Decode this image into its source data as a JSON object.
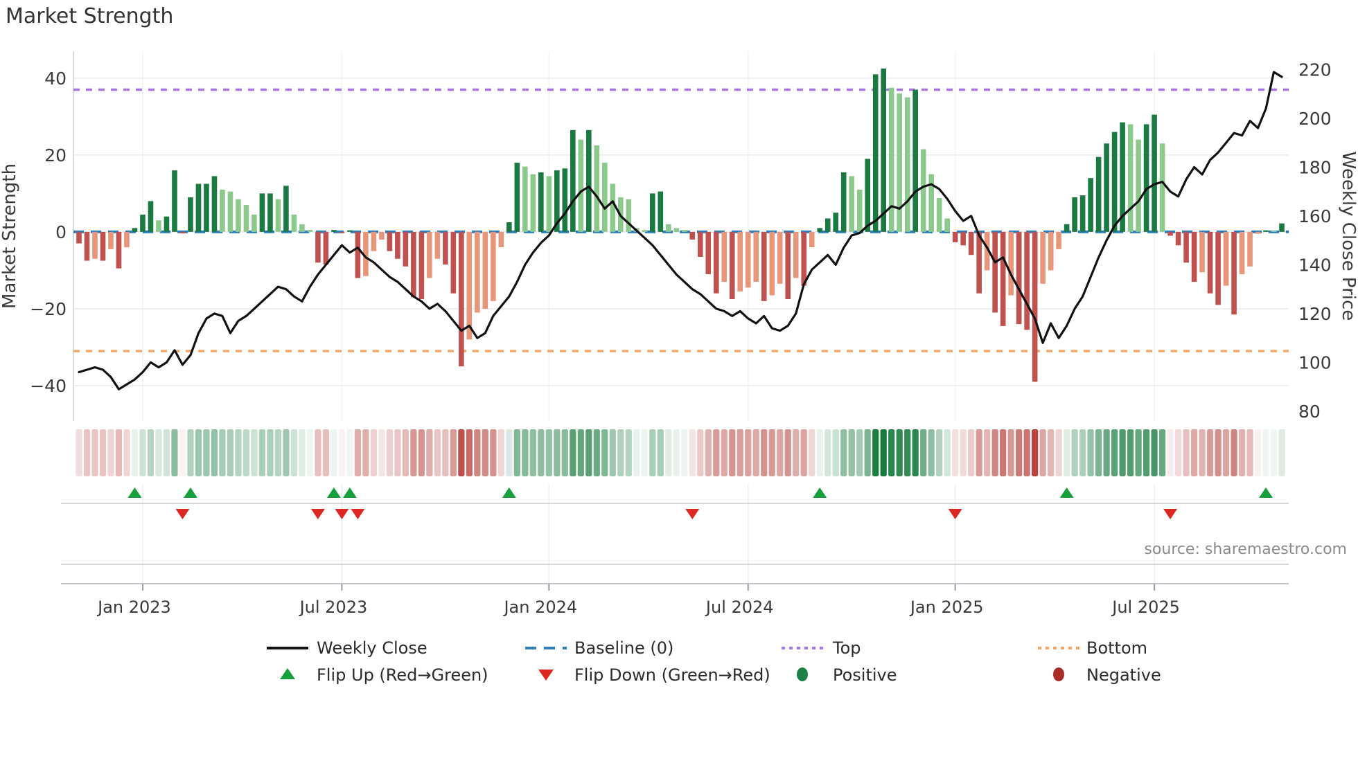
{
  "title": "Market Strength",
  "source_text": "source: sharemaestro.com",
  "axes": {
    "left_label": "Market Strength",
    "right_label": "Weekly Close Price",
    "left_ticks": [
      40,
      20,
      0,
      -20,
      -40
    ],
    "right_ticks": [
      220,
      200,
      180,
      160,
      140,
      120,
      100,
      80
    ],
    "x_ticks": [
      {
        "label": "Jan 2023",
        "week": 8
      },
      {
        "label": "Jul 2023",
        "week": 33
      },
      {
        "label": "Jan 2024",
        "week": 59
      },
      {
        "label": "Jul 2024",
        "week": 84
      },
      {
        "label": "Jan 2025",
        "week": 110
      },
      {
        "label": "Jul 2025",
        "week": 135
      }
    ]
  },
  "chart_data": {
    "type": "combo",
    "title": "Market Strength",
    "xlabel": "",
    "ylabel_left": "Market Strength",
    "ylabel_right": "Weekly Close Price",
    "ylim_left": [
      -49.2,
      47.0
    ],
    "ylim_right": [
      76,
      227.5
    ],
    "grid": true,
    "legend_position": "bottom",
    "baseline": 0,
    "top_line": 37,
    "bottom_line": -31,
    "weeks": 152,
    "series": [
      {
        "name": "Market Strength",
        "type": "bar",
        "values": [
          -3,
          -7.5,
          -7,
          -7.5,
          -4.5,
          -9.5,
          -4,
          1,
          4.5,
          8,
          3,
          4,
          16,
          -0.4,
          9,
          12.5,
          12.5,
          14.5,
          11,
          10.5,
          8.5,
          7,
          4.5,
          10,
          10,
          8.5,
          12,
          4.5,
          2,
          0.5,
          -8,
          -8.5,
          0.5,
          -0.3,
          0.4,
          -12,
          -11.5,
          -5,
          -2,
          -5,
          -7,
          -9,
          -17,
          -17.5,
          -12,
          -7,
          -8.5,
          -16,
          -35,
          -28,
          -21,
          -20,
          -18,
          -4,
          2.5,
          18,
          17,
          15,
          15.5,
          14.5,
          16,
          16.5,
          26.5,
          24,
          26.5,
          22.5,
          18,
          12.5,
          9,
          8.5,
          1,
          0.5,
          10,
          10.5,
          2,
          1,
          0.5,
          -2,
          -6.5,
          -11,
          -16,
          -13,
          -17.5,
          -15.5,
          -14.5,
          -13,
          -18,
          -16.5,
          -13.5,
          -17.5,
          -12,
          -14,
          -4,
          1,
          3.5,
          5,
          15.5,
          14.5,
          11,
          19,
          41,
          42.5,
          37.5,
          36,
          35,
          37,
          21.5,
          15,
          8.8,
          3.5,
          -2.7,
          -3.5,
          -6,
          -16,
          -10,
          -21,
          -24.5,
          -16.5,
          -24,
          -25.5,
          -39,
          -13.5,
          -10,
          -4.5,
          2,
          9,
          9.5,
          14,
          19.5,
          23,
          26,
          28.5,
          28,
          24,
          28,
          30.5,
          23,
          -1,
          -3.5,
          -8,
          -13,
          -10.5,
          -16,
          -19,
          -14,
          -21.5,
          -11,
          -9,
          -0.5,
          0.4,
          0.3,
          2.2
        ]
      },
      {
        "name": "Weekly Close",
        "type": "line",
        "values": [
          96,
          97,
          98,
          97,
          94,
          89,
          91,
          93,
          96,
          100,
          98,
          100,
          105,
          99,
          103,
          112,
          118,
          120,
          119,
          112,
          117,
          119,
          122,
          125,
          128,
          131,
          130,
          127,
          125,
          131,
          136,
          140,
          144,
          148,
          145,
          147,
          143,
          141,
          138,
          135,
          133,
          130,
          127,
          125,
          122,
          124,
          121,
          117,
          113,
          115,
          110,
          112,
          119,
          123,
          127,
          133,
          140,
          145,
          149,
          152,
          157,
          161,
          166,
          170,
          172,
          168,
          163,
          166,
          160,
          157,
          154,
          151,
          148,
          144,
          140,
          136,
          133,
          130,
          128,
          125,
          122,
          121,
          119,
          121,
          118,
          116,
          119,
          114,
          113,
          115,
          120,
          132,
          138,
          141,
          144,
          140,
          147,
          152,
          153,
          156,
          158,
          161,
          164,
          163,
          166,
          170,
          172,
          173,
          171,
          167,
          162,
          158,
          160,
          152,
          147,
          141,
          143,
          136,
          130,
          124,
          118,
          108,
          116,
          110,
          115,
          122,
          127,
          135,
          143,
          150,
          156,
          160,
          163,
          166,
          171,
          173,
          174,
          170,
          168,
          175,
          180,
          177,
          183,
          186,
          190,
          194,
          193,
          199,
          196,
          204,
          219,
          217
        ]
      }
    ],
    "flip_up_weeks": [
      7,
      14,
      32,
      34,
      54,
      93,
      124,
      149
    ],
    "flip_down_weeks": [
      13,
      30,
      33,
      35,
      77,
      110,
      137
    ]
  },
  "legend": {
    "rows": [
      [
        {
          "swatch": "line",
          "color": "#111111",
          "label": "Weekly Close"
        },
        {
          "swatch": "dashes",
          "color": "#2f7fbe",
          "label": "Baseline (0)"
        },
        {
          "swatch": "dots",
          "color": "#aa73e6",
          "label": "Top"
        },
        {
          "swatch": "dots",
          "color": "#f4a76a",
          "label": "Bottom"
        }
      ],
      [
        {
          "swatch": "tri-up",
          "color": "#15a03c",
          "label": "Flip Up (Red→Green)"
        },
        {
          "swatch": "tri-down",
          "color": "#dd2822",
          "label": "Flip Down (Green→Red)"
        },
        {
          "swatch": "dot",
          "color": "#1d8044",
          "label": "Positive"
        },
        {
          "swatch": "dot",
          "color": "#ab2d28",
          "label": "Negative"
        }
      ]
    ]
  },
  "colors": {
    "bar_dark_green": "#1b7a42",
    "bar_light_green": "#8cc98c",
    "bar_dark_red": "#bf524e",
    "bar_salmon": "#e8967a",
    "price_line": "#111111",
    "baseline": "#2f7fbe",
    "top_line": "#aa73e6",
    "bottom_line": "#f4a76a",
    "flip_up": "#15a03c",
    "flip_down": "#dd2822",
    "heat_green": "#157a3c",
    "heat_red": "#b23730",
    "grid": "#ebebf0",
    "spine": "#d4d4dc",
    "separator": "#cccccc",
    "tick_text": "#3a3a3a",
    "source_text": "#8b8b8b"
  }
}
